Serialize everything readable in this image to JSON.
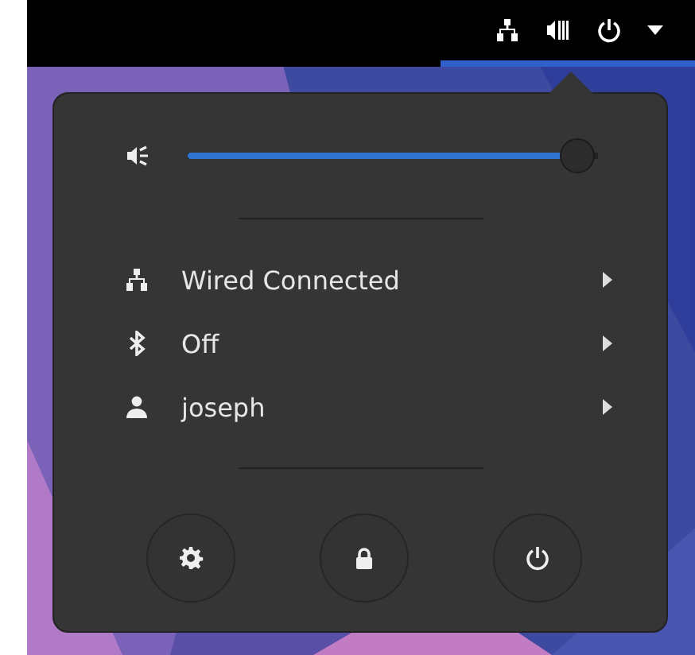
{
  "volume": {
    "level": 0.95
  },
  "items": [
    {
      "kind": "network",
      "label": "Wired Connected"
    },
    {
      "kind": "bluetooth",
      "label": "Off"
    },
    {
      "kind": "user",
      "label": "joseph"
    }
  ],
  "actions": [
    {
      "kind": "settings"
    },
    {
      "kind": "lock"
    },
    {
      "kind": "power"
    }
  ]
}
